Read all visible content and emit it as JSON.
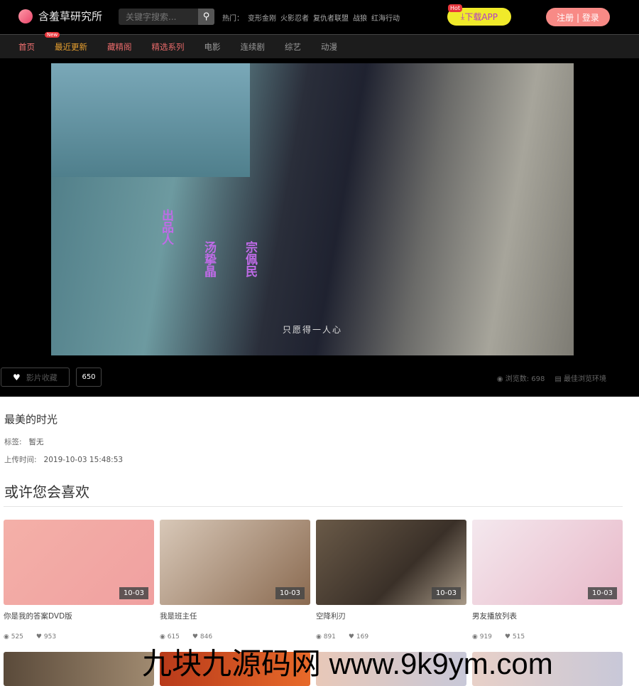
{
  "header": {
    "site_name": "含羞草研究所",
    "search_placeholder": "关键字搜索...",
    "hot_label": "热门：",
    "hot": [
      "变形金刚",
      "火影忍者",
      "复仇者联盟",
      "战狼",
      "红海行动"
    ],
    "app_badge": "Hot",
    "app_label": "下载APP",
    "login_label": "注册 | 登录"
  },
  "nav": {
    "new_badge": "New",
    "items": [
      {
        "label": "首页",
        "color": "#f07070"
      },
      {
        "label": "最近更新",
        "color": "#e8a030"
      },
      {
        "label": "藏精阁",
        "color": "#e86a6a"
      },
      {
        "label": "精选系列",
        "color": "#e86a6a"
      },
      {
        "label": "电影",
        "color": "#999999"
      },
      {
        "label": "连续剧",
        "color": "#999999"
      },
      {
        "label": "综艺",
        "color": "#999999"
      },
      {
        "label": "动漫",
        "color": "#999999"
      }
    ]
  },
  "player": {
    "subtitle": "只愿得一人心",
    "credits": [
      "出品人",
      "汤挚晶",
      "宗佩民"
    ],
    "fav_label": "影片收藏",
    "fav_count": "650",
    "views_label": "浏览数:",
    "views": "698",
    "env_label": "最佳浏览环境"
  },
  "video": {
    "title": "最美的时光",
    "tags_label": "标签:",
    "tags": "暂无",
    "upload_label": "上传时间:",
    "upload_time": "2019-10-03 15:48:53"
  },
  "related": {
    "heading": "或许您会喜欢",
    "items": [
      {
        "title": "你是我的答案DVD版",
        "date": "10-03",
        "views": "525",
        "likes": "953"
      },
      {
        "title": "我是班主任",
        "date": "10-03",
        "views": "615",
        "likes": "846"
      },
      {
        "title": "空降利刃",
        "date": "10-03",
        "views": "891",
        "likes": "169"
      },
      {
        "title": "男友播放列表",
        "date": "10-03",
        "views": "919",
        "likes": "515"
      }
    ]
  },
  "watermark": "九块九源码网 www.9k9ym.com"
}
